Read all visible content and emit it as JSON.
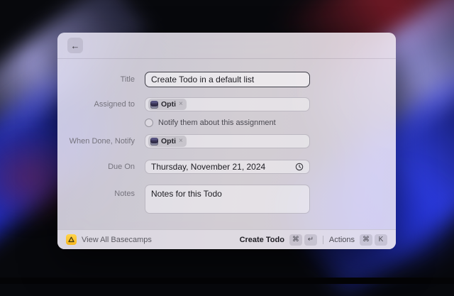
{
  "header": {
    "back_icon": "←"
  },
  "form": {
    "title": {
      "label": "Title",
      "value": "Create Todo in a default list"
    },
    "assigned_to": {
      "label": "Assigned to",
      "tag": {
        "name": "Opti",
        "remove_icon": "×"
      }
    },
    "notify": {
      "label": "Notify them about this assignment",
      "checked": false
    },
    "when_done": {
      "label": "When Done, Notify",
      "tag": {
        "name": "Opti",
        "remove_icon": "×"
      }
    },
    "due_on": {
      "label": "Due On",
      "value": "Thursday, November 21, 2024"
    },
    "notes": {
      "label": "Notes",
      "value": "Notes for this Todo"
    }
  },
  "footer": {
    "left": {
      "label": "View All Basecamps"
    },
    "primary": {
      "label": "Create Todo",
      "keys": [
        "⌘",
        "↵"
      ]
    },
    "secondary": {
      "label": "Actions",
      "keys": [
        "⌘",
        "K"
      ]
    }
  },
  "colors": {
    "accent_yellow": "#F6B71F",
    "focus_border": "#41404A",
    "wallpaper_blue": "#2A3AD8",
    "wallpaper_red": "#8A1E2C"
  }
}
